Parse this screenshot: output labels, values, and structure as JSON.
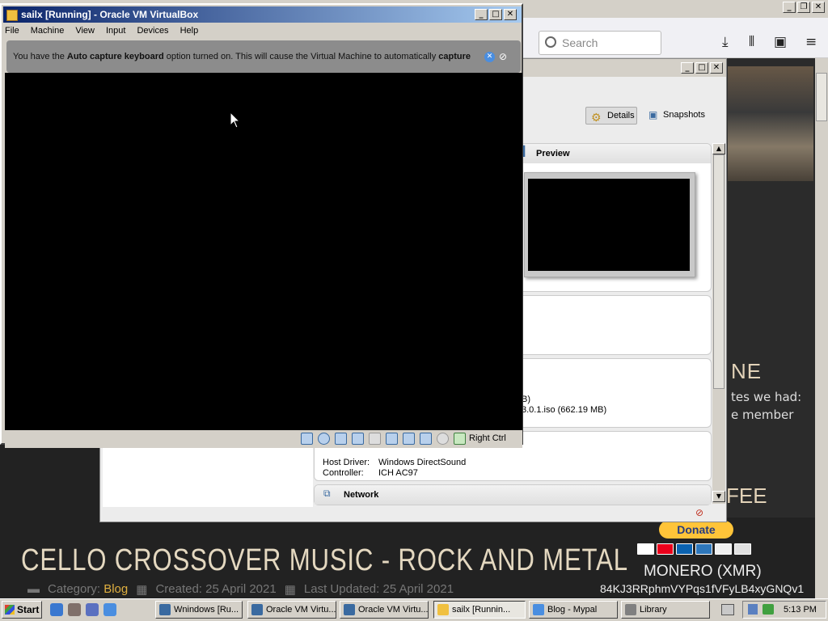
{
  "browser": {
    "search_placeholder": "Search",
    "sidebar_heading_fragment": "NE",
    "sidebar_text_1": "tes we had:",
    "sidebar_text_2": "e member",
    "sidebar_heading_2": "FEE",
    "donate_label": "Donate",
    "monero_label": "MONERO (XMR)",
    "monero_address": "84KJ3RRphmVYPqs1fVFyLB4xyGNQv1",
    "post_title": "CELLO CROSSOVER MUSIC - ROCK AND METAL",
    "meta": {
      "category_label": "Category:",
      "category_value": "Blog",
      "created": "Created: 25 April 2021",
      "updated": "Last Updated: 25 April 2021"
    }
  },
  "manager": {
    "details_label": "Details",
    "snapshots_label": "Snapshots",
    "preview_label": "Preview",
    "storage_line1": "B)",
    "storage_line2": "3.0.1.iso (662.19 MB)",
    "audio_host_driver_label": "Host Driver:",
    "audio_host_driver_value": "Windows DirectSound",
    "audio_controller_label": "Controller:",
    "audio_controller_value": "ICH AC97",
    "network_label": "Network"
  },
  "vm_window": {
    "title": "sailx [Running] - Oracle VM VirtualBox",
    "menu": [
      "File",
      "Machine",
      "View",
      "Input",
      "Devices",
      "Help"
    ],
    "notice_pre": "You have the ",
    "notice_bold1": "Auto capture keyboard",
    "notice_mid": " option turned on. This will cause the Virtual Machine to automatically ",
    "notice_bold2": "capture",
    "host_key": "Right Ctrl"
  },
  "taskbar": {
    "start_label": "Start",
    "items": [
      {
        "label": "Wnindows [Ru..."
      },
      {
        "label": "Oracle VM Virtu..."
      },
      {
        "label": "Oracle VM Virtu..."
      },
      {
        "label": "sailx [Runnin..."
      },
      {
        "label": "Blog - Mypal"
      },
      {
        "label": "Library"
      }
    ],
    "clock": "5:13 PM"
  },
  "colors": {
    "titlebar_start": "#0a246a",
    "titlebar_end": "#a6caf0",
    "donate": "#ffc439",
    "accent": "#e0b040"
  }
}
